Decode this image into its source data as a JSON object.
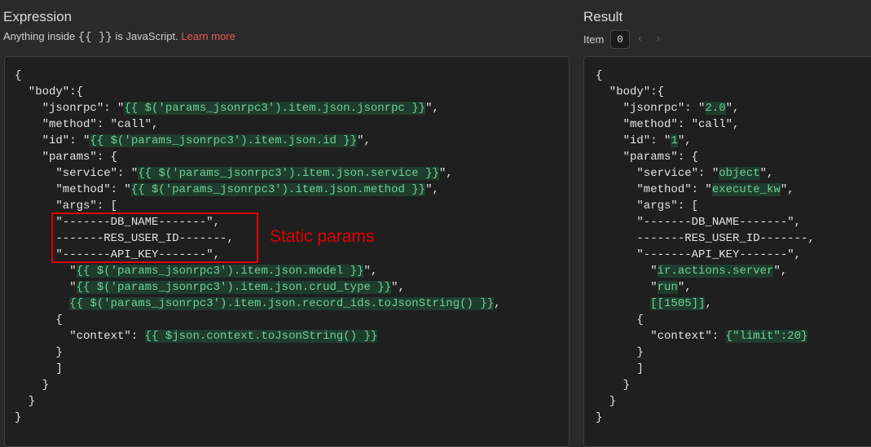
{
  "expression": {
    "title": "Expression",
    "hint_prefix": "Anything inside",
    "hint_braces": "{{  }}",
    "hint_suffix": "is JavaScript.",
    "learn_more": "Learn more",
    "lines": [
      [
        {
          "t": "{"
        }
      ],
      [
        {
          "t": "  \"body\":{"
        }
      ],
      [
        {
          "t": "    \"jsonrpc\": \""
        },
        {
          "t": "{{ $('params_jsonrpc3').item.json.jsonrpc }}",
          "hl": true
        },
        {
          "t": "\","
        }
      ],
      [
        {
          "t": "    \"method\": \"call\","
        }
      ],
      [
        {
          "t": "    \"id\": \""
        },
        {
          "t": "{{ $('params_jsonrpc3').item.json.id }}",
          "hl": true
        },
        {
          "t": "\","
        }
      ],
      [
        {
          "t": "    \"params\": {"
        }
      ],
      [
        {
          "t": "      \"service\": \""
        },
        {
          "t": "{{ $('params_jsonrpc3').item.json.service }}",
          "hl": true
        },
        {
          "t": "\","
        }
      ],
      [
        {
          "t": "      \"method\": \""
        },
        {
          "t": "{{ $('params_jsonrpc3').item.json.method }}",
          "hl": true
        },
        {
          "t": "\","
        }
      ],
      [
        {
          "t": "      \"args\": ["
        }
      ],
      [
        {
          "t": "      \"-------DB_NAME-------\","
        }
      ],
      [
        {
          "t": "      -------RES_USER_ID-------,"
        }
      ],
      [
        {
          "t": "      \"-------API_KEY-------\","
        }
      ],
      [
        {
          "t": "        \""
        },
        {
          "t": "{{ $('params_jsonrpc3').item.json.model }}",
          "hl": true
        },
        {
          "t": "\","
        }
      ],
      [
        {
          "t": "        \""
        },
        {
          "t": "{{ $('params_jsonrpc3').item.json.crud_type }}",
          "hl": true
        },
        {
          "t": "\","
        }
      ],
      [
        {
          "t": "        "
        },
        {
          "t": "{{ $('params_jsonrpc3').item.json.record_ids.toJsonString() }}",
          "hl": true
        },
        {
          "t": ","
        }
      ],
      [
        {
          "t": "      {"
        }
      ],
      [
        {
          "t": "        \"context\": "
        },
        {
          "t": "{{ $json.context.toJsonString() }}",
          "hl": true
        }
      ],
      [
        {
          "t": "      }"
        }
      ],
      [
        {
          "t": "      ]"
        }
      ],
      [
        {
          "t": "    }"
        }
      ],
      [
        {
          "t": "  }"
        }
      ],
      [
        {
          "t": "}"
        }
      ]
    ]
  },
  "annotation": "Static params",
  "result": {
    "title": "Result",
    "item_label": "Item",
    "item_value": "0",
    "prev": "‹",
    "next": "›",
    "lines": [
      [
        {
          "t": "{"
        }
      ],
      [
        {
          "t": "  \"body\":{"
        }
      ],
      [
        {
          "t": "    \"jsonrpc\": \""
        },
        {
          "t": "2.0",
          "hl": true
        },
        {
          "t": "\","
        }
      ],
      [
        {
          "t": "    \"method\": \"call\","
        }
      ],
      [
        {
          "t": "    \"id\": \""
        },
        {
          "t": "1",
          "hl": true
        },
        {
          "t": "\","
        }
      ],
      [
        {
          "t": "    \"params\": {"
        }
      ],
      [
        {
          "t": "      \"service\": \""
        },
        {
          "t": "object",
          "hl": true
        },
        {
          "t": "\","
        }
      ],
      [
        {
          "t": "      \"method\": \""
        },
        {
          "t": "execute_kw",
          "hl": true
        },
        {
          "t": "\","
        }
      ],
      [
        {
          "t": "      \"args\": ["
        }
      ],
      [
        {
          "t": "      \"-------DB_NAME-------\","
        }
      ],
      [
        {
          "t": "      -------RES_USER_ID-------,"
        }
      ],
      [
        {
          "t": "      \"-------API_KEY-------\","
        }
      ],
      [
        {
          "t": "        \""
        },
        {
          "t": "ir.actions.server",
          "hl": true
        },
        {
          "t": "\","
        }
      ],
      [
        {
          "t": "        \""
        },
        {
          "t": "run",
          "hl": true
        },
        {
          "t": "\","
        }
      ],
      [
        {
          "t": "        "
        },
        {
          "t": "[[1505]]",
          "hl": true
        },
        {
          "t": ","
        }
      ],
      [
        {
          "t": "      {"
        }
      ],
      [
        {
          "t": "        \"context\": "
        },
        {
          "t": "{\"limit\":20}",
          "hl": true
        }
      ],
      [
        {
          "t": "      }"
        }
      ],
      [
        {
          "t": "      ]"
        }
      ],
      [
        {
          "t": "    }"
        }
      ],
      [
        {
          "t": "  }"
        }
      ],
      [
        {
          "t": "}"
        }
      ]
    ]
  }
}
